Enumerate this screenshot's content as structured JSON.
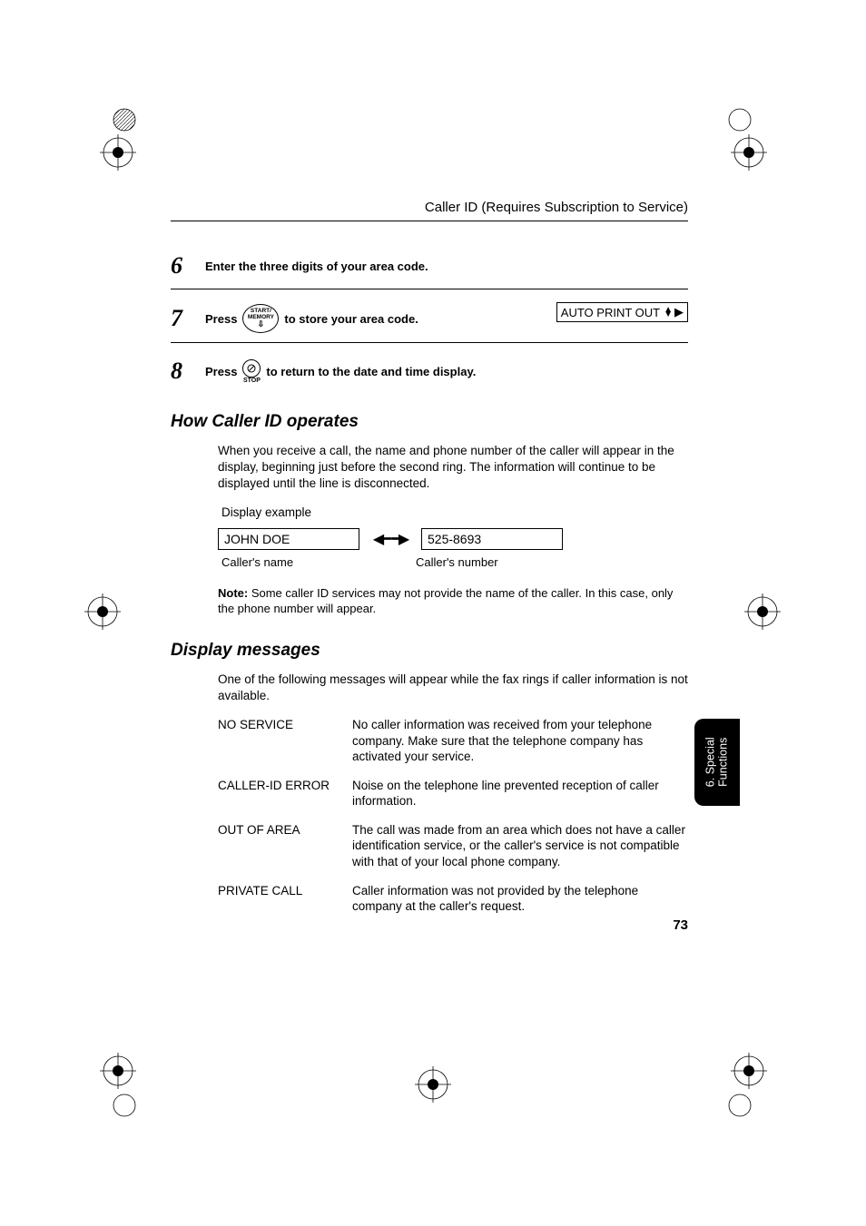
{
  "header": {
    "title": "Caller ID (Requires Subscription to Service)"
  },
  "steps": {
    "s6": {
      "num": "6",
      "text": "Enter the three digits of your area code."
    },
    "s7": {
      "num": "7",
      "press": "Press",
      "btn_l1": "START/",
      "btn_l2": "MEMORY",
      "after": " to store your area code.",
      "lcd": "AUTO PRINT OUT"
    },
    "s8": {
      "num": "8",
      "press": "Press",
      "stop": "STOP",
      "after": " to return to the date and time display."
    }
  },
  "section1": {
    "head": "How Caller ID operates",
    "body": "When you receive a call, the name and phone number of the caller will appear in the display, beginning just before the second ring. The information will continue to be displayed until the line is disconnected.",
    "example_label": "Display example",
    "name_box": "JOHN DOE",
    "num_box": "525-8693",
    "name_cap": "Caller's name",
    "num_cap": "Caller's number",
    "note_label": "Note:",
    "note_body": " Some caller ID services may not provide the name of the caller. In this case, only the phone number will appear."
  },
  "section2": {
    "head": "Display messages",
    "intro": "One of the following messages will appear while the fax rings if caller information is not available.",
    "rows": [
      {
        "label": "NO SERVICE",
        "desc": "No caller information was received from your telephone company. Make sure that the telephone company has activated your service."
      },
      {
        "label": "CALLER-ID ERROR",
        "desc": "Noise on the telephone line prevented reception of caller information."
      },
      {
        "label": "OUT OF AREA",
        "desc": "The call was made from an area which does not have a caller identification service, or the caller's service is not compatible with that of your local phone company."
      },
      {
        "label": "PRIVATE CALL",
        "desc": "Caller information was not provided by the telephone company at the caller's request."
      }
    ]
  },
  "sidebar": {
    "text": "6. Special\nFunctions"
  },
  "page_number": "73"
}
